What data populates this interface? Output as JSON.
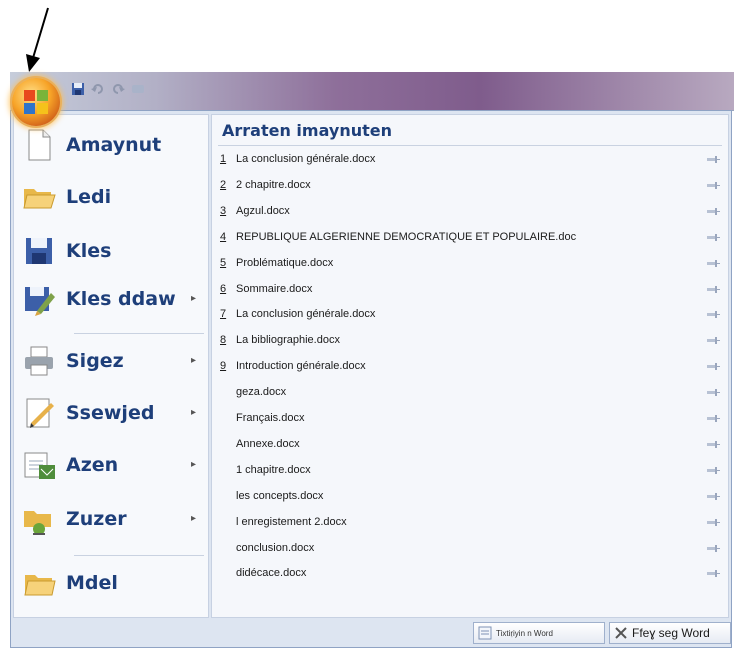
{
  "annotation": {
    "icon": "arrow-pointing-to-office-button"
  },
  "titlebar": {
    "quick_access": [
      "save-icon",
      "undo-icon",
      "redo-icon",
      "customize-icon"
    ]
  },
  "office_button": {
    "icon": "office-logo"
  },
  "commands": [
    {
      "label": "Amaynut",
      "icon": "new-document-icon",
      "submenu": false
    },
    {
      "label": "Ledi",
      "icon": "open-folder-icon",
      "submenu": false
    },
    {
      "label": "Kles",
      "icon": "save-icon",
      "submenu": false
    },
    {
      "label": "Kles ddaw",
      "icon": "save-as-icon",
      "submenu": true
    },
    {
      "label": "Sigez",
      "icon": "print-icon",
      "submenu": true
    },
    {
      "label": "Ssewjed",
      "icon": "prepare-icon",
      "submenu": true
    },
    {
      "label": "Azen",
      "icon": "send-icon",
      "submenu": true
    },
    {
      "label": "Zuzer",
      "icon": "publish-icon",
      "submenu": true
    },
    {
      "label": "Mdel",
      "icon": "close-icon",
      "submenu": false
    }
  ],
  "recent": {
    "title": "Arraten imaynuten",
    "items": [
      {
        "num": "1",
        "name": "La conclusion générale.docx"
      },
      {
        "num": "2",
        "name": "2 chapitre.docx"
      },
      {
        "num": "3",
        "name": "Agzul.docx"
      },
      {
        "num": "4",
        "name": "REPUBLIQUE ALGERIENNE DEMOCRATIQUE ET POPULAIRE.doc"
      },
      {
        "num": "5",
        "name": "Problématique.docx"
      },
      {
        "num": "6",
        "name": "Sommaire.docx"
      },
      {
        "num": "7",
        "name": "La conclusion générale.docx"
      },
      {
        "num": "8",
        "name": "La bibliographie.docx"
      },
      {
        "num": "9",
        "name": "Introduction  générale.docx"
      },
      {
        "num": "",
        "name": "geza.docx"
      },
      {
        "num": "",
        "name": "Français.docx"
      },
      {
        "num": "",
        "name": "Annexe.docx"
      },
      {
        "num": "",
        "name": "1 chapitre.docx"
      },
      {
        "num": "",
        "name": "les concepts.docx"
      },
      {
        "num": "",
        "name": "l enregistement 2.docx"
      },
      {
        "num": "",
        "name": "conclusion.docx"
      },
      {
        "num": "",
        "name": "didécace.docx"
      }
    ]
  },
  "footer": {
    "options_label": "Tixtiṛiyin n Word",
    "exit_label": "Ffeɣ seg Word"
  }
}
